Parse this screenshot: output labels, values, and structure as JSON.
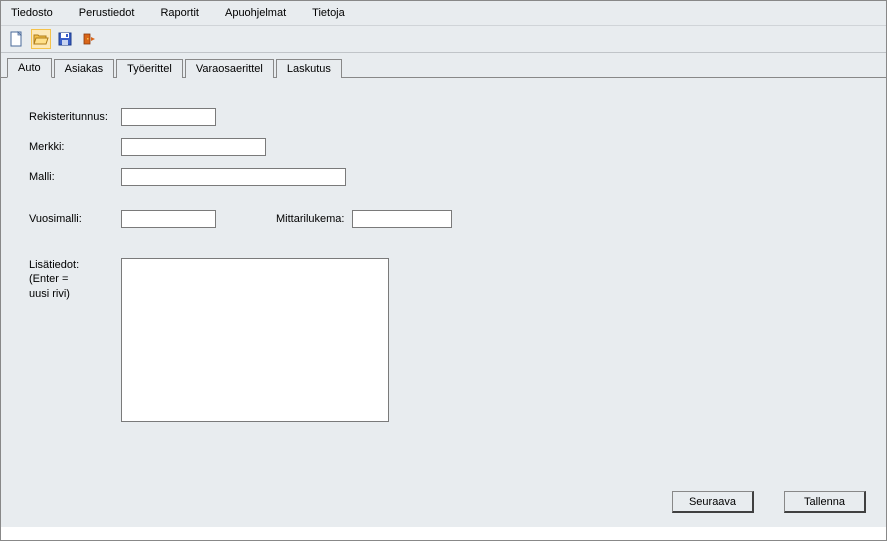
{
  "menu": {
    "items": [
      "Tiedosto",
      "Perustiedot",
      "Raportit",
      "Apuohjelmat",
      "Tietoja"
    ]
  },
  "toolbar": {
    "icons": [
      "new-file-icon",
      "open-folder-icon",
      "save-icon",
      "exit-icon"
    ]
  },
  "tabs": {
    "items": [
      "Auto",
      "Asiakas",
      "Työerittel",
      "Varaosaerittel",
      "Laskutus"
    ],
    "active": 0
  },
  "form": {
    "rekisteritunnus": {
      "label": "Rekisteritunnus:",
      "value": ""
    },
    "merkki": {
      "label": "Merkki:",
      "value": ""
    },
    "malli": {
      "label": "Malli:",
      "value": ""
    },
    "vuosimalli": {
      "label": "Vuosimalli:",
      "value": ""
    },
    "mittarilukema": {
      "label": "Mittarilukema:",
      "value": ""
    },
    "lisatiedot": {
      "label_line1": "Lisätiedot:",
      "label_line2": "(Enter =",
      "label_line3": "uusi rivi)",
      "value": ""
    }
  },
  "buttons": {
    "seuraava": "Seuraava",
    "tallenna": "Tallenna"
  }
}
